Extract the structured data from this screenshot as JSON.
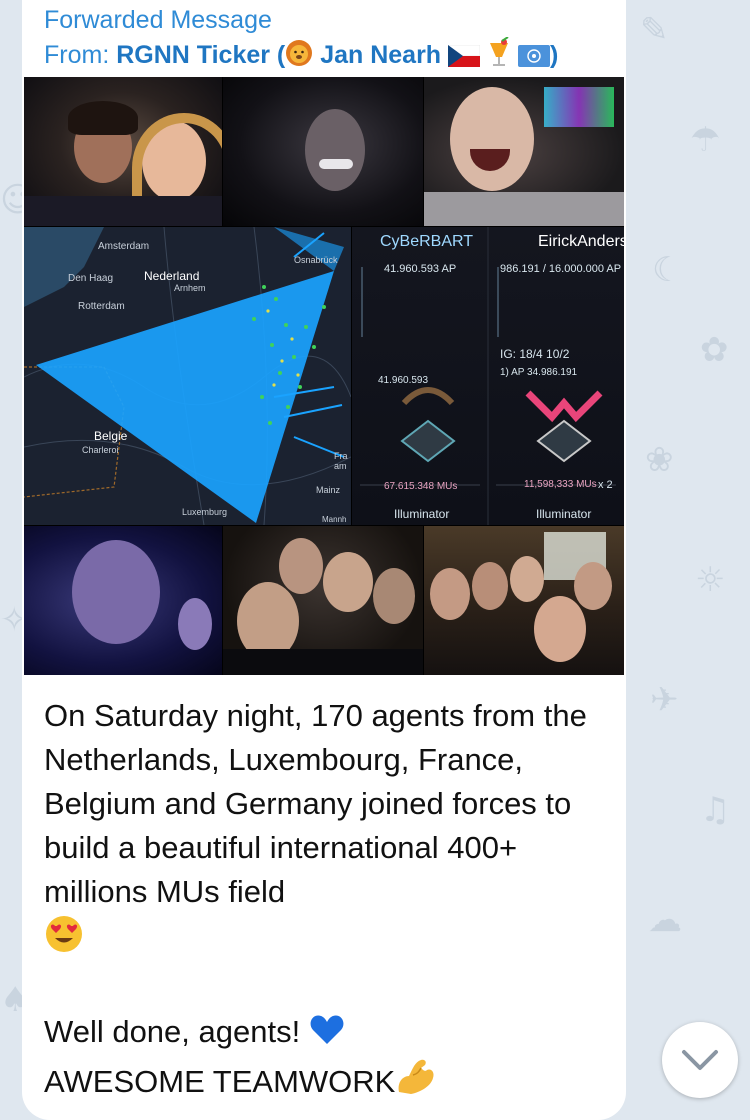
{
  "forward": {
    "label": "Forwarded Message",
    "from_prefix": "From: ",
    "from_name": "RGNN Ticker (",
    "from_name_mid": " Jan Nearh ",
    "from_name_end": ")"
  },
  "photo": {
    "map_labels": {
      "amsterdam": "Amsterdam",
      "den_haag": "Den Haag",
      "nederland": "Nederland",
      "arnhem": "Arnhem",
      "rotterdam": "Rotterdam",
      "osnabruck": "Osnabrück",
      "belgie": "Belgie",
      "charleroi": "Charleroi",
      "luxemburg": "Luxemburg",
      "mainz": "Mainz",
      "fra": "Fra",
      "am": "am",
      "mannh": "Mannh"
    },
    "game": {
      "agent_enl": "CyBeRBART",
      "agent_res": "EirickAnders",
      "ap_enl": "41.960.593 AP",
      "ap_res": "986.191 / 16.000.000 AP",
      "level_info": "IG: 18/4 10/2",
      "ap_line": "1) AP 34.986.191",
      "ap_enl_small": "41.960.593",
      "mus_enl": "67.615.348 MUs",
      "mus_res": "11,598,333 MUs",
      "mus_res_mult": "x 2",
      "badge_enl": "Illuminator",
      "badge_res": "Illuminator"
    }
  },
  "message": {
    "body": "On Saturday night, 170 agents from the Netherlands, Luxembourg, France, Belgium and Germany joined forces to build a beautiful international 400+ millions MUs field",
    "closing_1": "Well done, agents!",
    "closing_2": "AWESOME TEAMWORK"
  },
  "icons": {
    "lion": "lion-face-icon",
    "czech_flag": "czech-flag-icon",
    "cocktail": "tropical-drink-icon",
    "un_flag": "un-flag-icon",
    "heart_eyes": "heart-eyes-emoji-icon",
    "blue_heart": "blue-heart-icon",
    "muscle": "flexed-biceps-icon",
    "chevron": "chevron-down-icon"
  },
  "colors": {
    "link_blue": "#2f8bd6",
    "field_blue": "#1aa3ff",
    "res_pink": "#e9457a",
    "enl_green": "#3fd35a"
  }
}
